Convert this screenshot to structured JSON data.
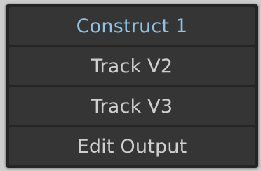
{
  "menu": {
    "items": [
      {
        "label": "Construct 1",
        "selected": true
      },
      {
        "label": "Track V2",
        "selected": false
      },
      {
        "label": "Track V3",
        "selected": false
      },
      {
        "label": "Edit Output",
        "selected": false
      }
    ],
    "colors": {
      "selected_text": "#8fc2e6",
      "text": "#cfcfcf",
      "item_bg": "#353535",
      "menu_bg": "#252525"
    }
  }
}
